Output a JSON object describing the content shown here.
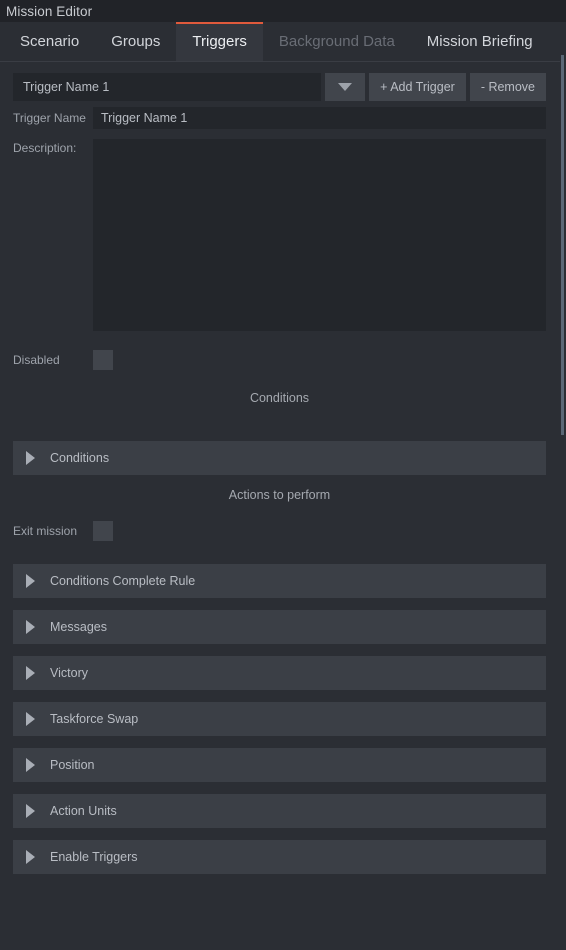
{
  "window": {
    "title": "Mission Editor"
  },
  "tabs": [
    {
      "label": "Scenario",
      "state": "normal"
    },
    {
      "label": "Groups",
      "state": "normal"
    },
    {
      "label": "Triggers",
      "state": "active"
    },
    {
      "label": "Background Data",
      "state": "disabled"
    },
    {
      "label": "Mission Briefing",
      "state": "normal"
    }
  ],
  "selector": {
    "selected_trigger": "Trigger Name 1",
    "dropdown_icon": "chevron-down-icon",
    "add_label": "+ Add Trigger",
    "remove_label": "- Remove"
  },
  "fields": {
    "trigger_name_label": "Trigger Name",
    "trigger_name_value": "Trigger Name 1",
    "description_label": "Description:",
    "description_value": "",
    "description_placeholder": "",
    "disabled_label": "Disabled",
    "disabled_checked": false,
    "exit_mission_label": "Exit mission",
    "exit_mission_checked": false
  },
  "sections": {
    "conditions_caption": "Conditions",
    "conditions_panel_label": "Conditions",
    "actions_caption": "Actions to perform"
  },
  "action_panels": [
    {
      "label": "Conditions Complete Rule",
      "expand_icon": "triangle-right-icon"
    },
    {
      "label": "Messages",
      "expand_icon": "triangle-right-icon"
    },
    {
      "label": "Victory",
      "expand_icon": "triangle-right-icon"
    },
    {
      "label": "Taskforce Swap",
      "expand_icon": "triangle-right-icon"
    },
    {
      "label": "Position",
      "expand_icon": "triangle-right-icon"
    },
    {
      "label": "Action Units",
      "expand_icon": "triangle-right-icon"
    },
    {
      "label": "Enable Triggers",
      "expand_icon": "triangle-right-icon"
    }
  ],
  "colors": {
    "background": "#2b2e34",
    "titlebar": "#212328",
    "active_tab_accent": "#e05a3c",
    "panel": "#3b3f46",
    "input": "#23262b",
    "button": "#41454c",
    "text": "#b9bdc4"
  }
}
